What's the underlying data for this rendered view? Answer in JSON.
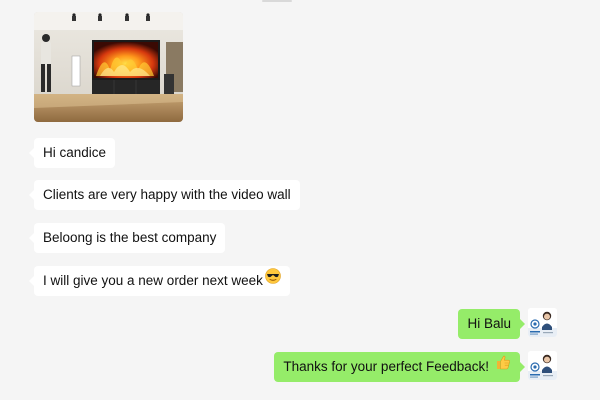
{
  "chat": {
    "incoming": [
      {
        "text": "Hi candice"
      },
      {
        "text": "Clients are very happy with the video wall"
      },
      {
        "text": "Beloong is the best company"
      },
      {
        "text": "I will give you a new order next week"
      }
    ],
    "outgoing": [
      {
        "text": "Hi Balu"
      },
      {
        "text": "Thanks for your perfect Feedback!"
      }
    ],
    "icons": {
      "sunglasses": "sunglasses-emoji",
      "thumbs_up": "thumbs-up-emoji",
      "avatar": "user-avatar"
    },
    "colors": {
      "background": "#f5f5f5",
      "incoming_bubble": "#ffffff",
      "outgoing_bubble": "#95ec69"
    }
  }
}
